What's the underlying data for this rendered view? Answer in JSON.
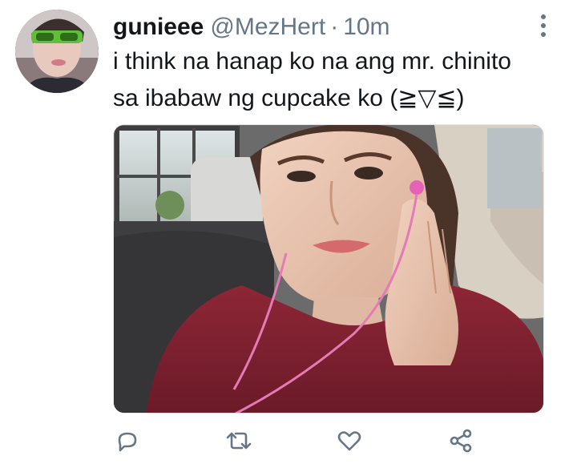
{
  "tweet": {
    "author_name": "gunieee",
    "author_handle": "@MezHert",
    "separator": "·",
    "timestamp": "10m",
    "text_lines": [
      "i think na hanap ko na ang mr. chinito",
      "sa ibabaw ng cupcake ko (≧▽≦)"
    ]
  },
  "icons": {
    "more": "more-vertical-icon",
    "reply": "reply-icon",
    "retweet": "retweet-icon",
    "like": "heart-icon",
    "share": "share-icon"
  },
  "colors": {
    "text": "#14171a",
    "secondary": "#657786",
    "icon": "#657786",
    "border": "#e1e8ed"
  }
}
